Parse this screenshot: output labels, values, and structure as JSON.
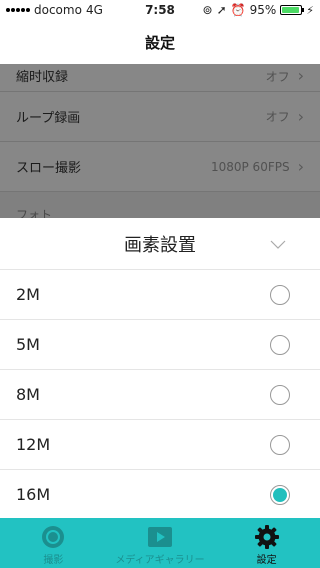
{
  "status_bar": {
    "carrier": "docomo",
    "network": "4G",
    "time": "7:58",
    "battery_percent": "95%",
    "battery_level": 0.95
  },
  "nav": {
    "title": "設定"
  },
  "settings": {
    "rows": [
      {
        "label": "縮时収録",
        "value": "オフ"
      },
      {
        "label": "ループ録画",
        "value": "オフ"
      },
      {
        "label": "スロー撮影",
        "value": "1080P 60FPS"
      }
    ],
    "section_header": "フォト"
  },
  "sheet": {
    "title": "画素設置",
    "options": [
      {
        "label": "2M",
        "selected": false
      },
      {
        "label": "5M",
        "selected": false
      },
      {
        "label": "8M",
        "selected": false
      },
      {
        "label": "12M",
        "selected": false
      },
      {
        "label": "16M",
        "selected": true
      }
    ]
  },
  "tab_bar": {
    "tabs": [
      {
        "label": "撮影",
        "icon": "camera-lens-icon",
        "active": false
      },
      {
        "label": "メディアギャラリー",
        "icon": "play-icon",
        "active": false
      },
      {
        "label": "設定",
        "icon": "gear-icon",
        "active": true
      }
    ],
    "accent_color": "#22c2c2"
  }
}
